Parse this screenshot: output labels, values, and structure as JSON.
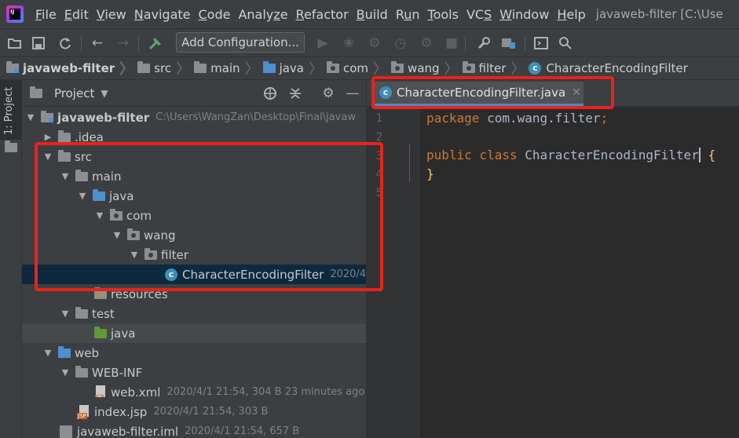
{
  "app": {
    "menu": [
      {
        "label": "File",
        "u": "F"
      },
      {
        "label": "Edit",
        "u": "E"
      },
      {
        "label": "View",
        "u": "V"
      },
      {
        "label": "Navigate",
        "u": "N"
      },
      {
        "label": "Code",
        "u": "C"
      },
      {
        "label": "Analyze",
        "u": "z"
      },
      {
        "label": "Refactor",
        "u": "R"
      },
      {
        "label": "Build",
        "u": "B"
      },
      {
        "label": "Run",
        "u": "u"
      },
      {
        "label": "Tools",
        "u": "T"
      },
      {
        "label": "VCS",
        "u": "S"
      },
      {
        "label": "Window",
        "u": "W"
      },
      {
        "label": "Help",
        "u": "H"
      }
    ],
    "window_title": "javaweb-filter [C:\\Use"
  },
  "toolbar": {
    "add_configuration": "Add Configuration..."
  },
  "breadcrumb": [
    "javaweb-filter",
    "src",
    "main",
    "java",
    "com",
    "wang",
    "filter",
    "CharacterEncodingFilter"
  ],
  "left_strip": {
    "project_label": "1: Project"
  },
  "project_panel": {
    "title": "Project",
    "tree": [
      {
        "label": "javaweb-filter",
        "meta": "C:\\Users\\WangZan\\Desktop\\Final\\javaw"
      },
      {
        "label": ".idea"
      },
      {
        "label": "src"
      },
      {
        "label": "main"
      },
      {
        "label": "java"
      },
      {
        "label": "com"
      },
      {
        "label": "wang"
      },
      {
        "label": "filter"
      },
      {
        "label": "CharacterEncodingFilter",
        "meta": "2020/4/"
      },
      {
        "label": "resources"
      },
      {
        "label": "test"
      },
      {
        "label": "java"
      },
      {
        "label": "web"
      },
      {
        "label": "WEB-INF"
      },
      {
        "label": "web.xml",
        "meta": "2020/4/1 21:54, 304 B 23 minutes ago"
      },
      {
        "label": "index.jsp",
        "meta": "2020/4/1 21:54, 303 B"
      },
      {
        "label": "javaweb-filter.iml",
        "meta": "2020/4/1 21:54, 657 B"
      }
    ]
  },
  "editor": {
    "tab_label": "CharacterEncodingFilter.java",
    "line_numbers": [
      "1",
      "2",
      "3",
      "4",
      "5"
    ],
    "code": {
      "l1_kw": "package",
      "l1_pkg": " com.wang.filter",
      "l1_semi": ";",
      "l3_kw": "public class ",
      "l3_name": "CharacterEncodingFilter",
      "l3_space": " ",
      "l3_brace": "{",
      "l4_brace": "}"
    }
  },
  "colors": {
    "annotation_red": "#e8231c",
    "selection_blue": "#0d293e",
    "tab_underline": "#4a88c7"
  }
}
